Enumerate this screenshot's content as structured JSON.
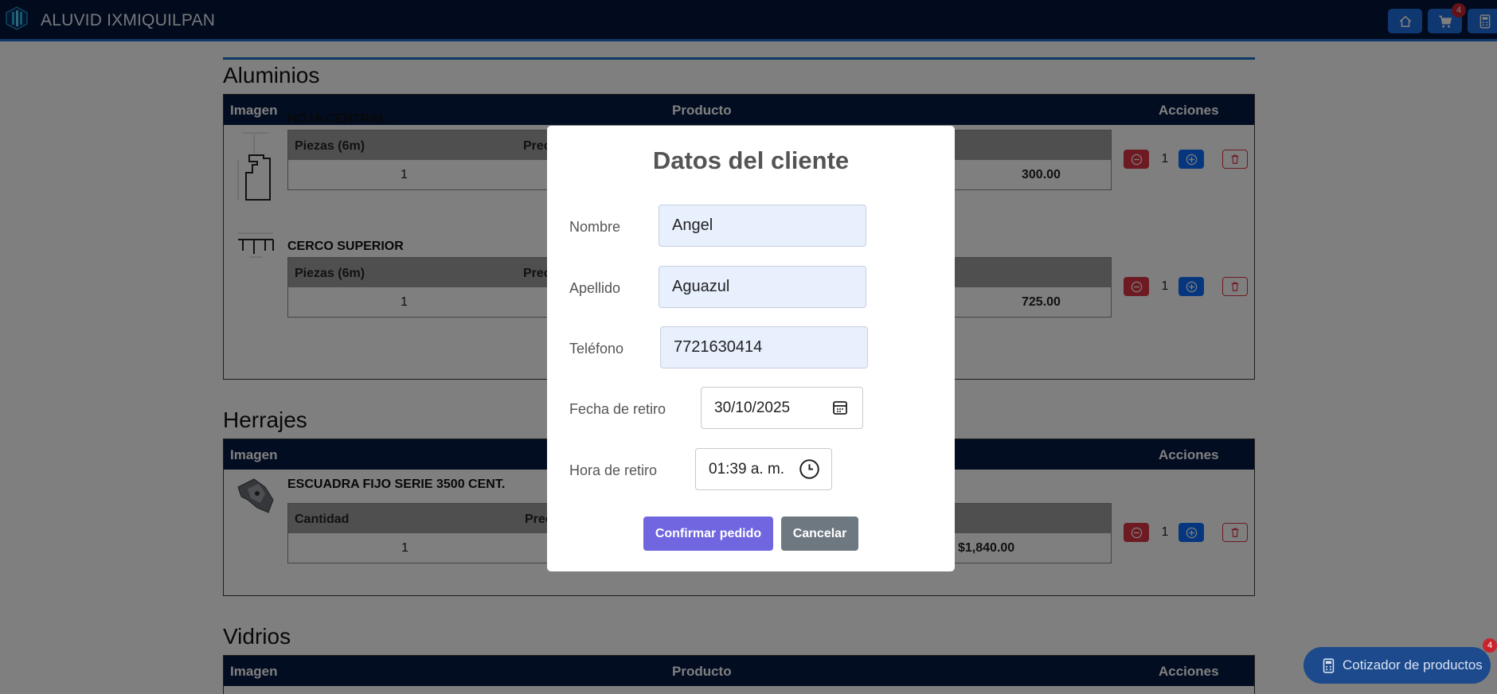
{
  "navbar": {
    "brand": "ALUVID IXMIQUILPAN",
    "cart_badge": "4",
    "icons": {
      "home": "home-icon",
      "cart": "cart-icon",
      "calculator": "calculator-icon"
    }
  },
  "table_headers": {
    "imagen": "Imagen",
    "producto": "Producto",
    "acciones": "Acciones"
  },
  "sections": {
    "aluminios": {
      "title": "Aluminios",
      "items": [
        {
          "name": "HOJA CENTRAL",
          "col1": "Piezas (6m)",
          "col2": "Prec",
          "qty": "1",
          "price": "300.00",
          "count": "1"
        },
        {
          "name": "CERCO SUPERIOR",
          "col1": "Piezas (6m)",
          "col2": "Prec",
          "qty": "1",
          "price": "725.00",
          "count": "1"
        }
      ]
    },
    "herrajes": {
      "title": "Herrajes",
      "items": [
        {
          "name": "ESCUADRA FIJO SERIE 3500 CENT.",
          "col1": "Cantidad",
          "col2": "Prec",
          "qty": "1",
          "price": "$1,840.00",
          "count": "1"
        }
      ]
    },
    "vidrios": {
      "title": "Vidrios"
    }
  },
  "fab": {
    "label": "Cotizador de productos",
    "badge": "4"
  },
  "modal": {
    "title": "Datos del cliente",
    "fields": {
      "nombre": {
        "label": "Nombre",
        "value": "Angel"
      },
      "apellido": {
        "label": "Apellido",
        "value": "Aguazul"
      },
      "telefono": {
        "label": "Teléfono",
        "value": "7721630414"
      },
      "fecha": {
        "label": "Fecha de retiro",
        "value": "30/10/2025"
      },
      "hora": {
        "label": "Hora de retiro",
        "value": "01:39 a. m."
      }
    },
    "confirm_label": "Confirmar pedido",
    "cancel_label": "Cancelar"
  },
  "colors": {
    "navbar": "#04163a",
    "table_header": "#071b45",
    "accent_blue": "#0d6efd",
    "danger": "#dc3545",
    "confirm": "#7066e0",
    "cancel": "#6e7881"
  }
}
